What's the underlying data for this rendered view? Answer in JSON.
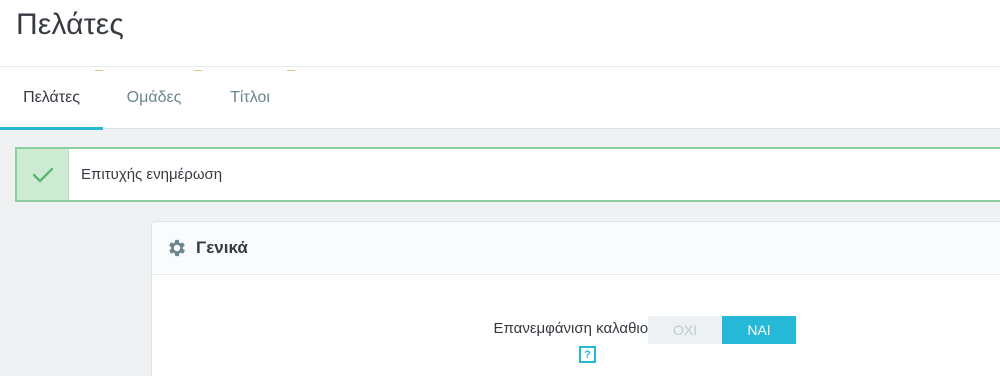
{
  "header": {
    "title": "Πελάτες"
  },
  "tabs": [
    {
      "label": "Πελάτες",
      "active": true
    },
    {
      "label": "Ομάδες",
      "active": false
    },
    {
      "label": "Τίτλοι",
      "active": false
    }
  ],
  "alert": {
    "message": "Επιτυχής ενημέρωση",
    "icon": "check-icon",
    "color": "#8bcf9e"
  },
  "panel": {
    "title": "Γενικά",
    "icon": "gear-icon",
    "field": {
      "label": "Επανεμφάνιση καλαθιού με τη σύνδεση",
      "help": "?",
      "options": [
        "ΟΧΙ",
        "ΝΑΙ"
      ],
      "selected": "ΝΑΙ"
    }
  },
  "colors": {
    "accent": "#25b9d7",
    "success": "#8bcf9e"
  }
}
